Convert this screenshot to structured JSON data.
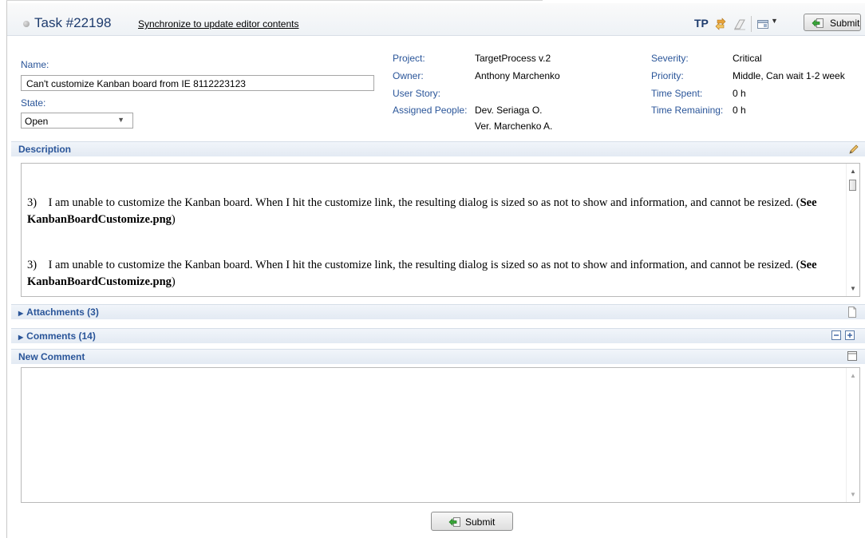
{
  "header": {
    "title": "Task #22198",
    "sync_link": "Synchronize to update editor contents",
    "tp_label": "TP",
    "submit_label": "Submit"
  },
  "fields": {
    "name_label": "Name:",
    "name_value": "Can't customize Kanban board from IE 8112223123",
    "state_label": "State:",
    "state_value": "Open",
    "project_label": "Project:",
    "project_value": "TargetProcess v.2",
    "owner_label": "Owner:",
    "owner_value": "Anthony Marchenko",
    "user_story_label": "User Story:",
    "user_story_value": "",
    "assigned_label": "Assigned People:",
    "assigned_values": [
      "Dev. Seriaga O.",
      "Ver. Marchenko A."
    ],
    "severity_label": "Severity:",
    "severity_value": "Critical",
    "priority_label": "Priority:",
    "priority_value": "Middle, Can wait 1-2 week",
    "time_spent_label": "Time Spent:",
    "time_spent_value": "0 h",
    "time_remaining_label": "Time Remaining:",
    "time_remaining_value": "0 h"
  },
  "description": {
    "label": "Description",
    "paragraphs": [
      {
        "num": "3)",
        "text": "I am unable to customize the Kanban board. When I hit the customize link, the resulting dialog is sized so as not to show and information, and cannot be resized. (",
        "bold": "See KanbanBoardCustomize.png",
        "end": ")"
      },
      {
        "num": "3)",
        "text": "I am unable to customize the Kanban board. When I hit the customize link, the resulting dialog is sized so as not to show and information, and cannot be resized. (",
        "bold": "See KanbanBoardCustomize.png",
        "end": ")"
      }
    ]
  },
  "sections": {
    "attachments": "Attachments (3)",
    "comments": "Comments (14)",
    "new_comment": "New Comment"
  },
  "footer": {
    "submit_label": "Submit"
  },
  "colors": {
    "accent": "#2a5599",
    "title": "#1e3c6e"
  }
}
